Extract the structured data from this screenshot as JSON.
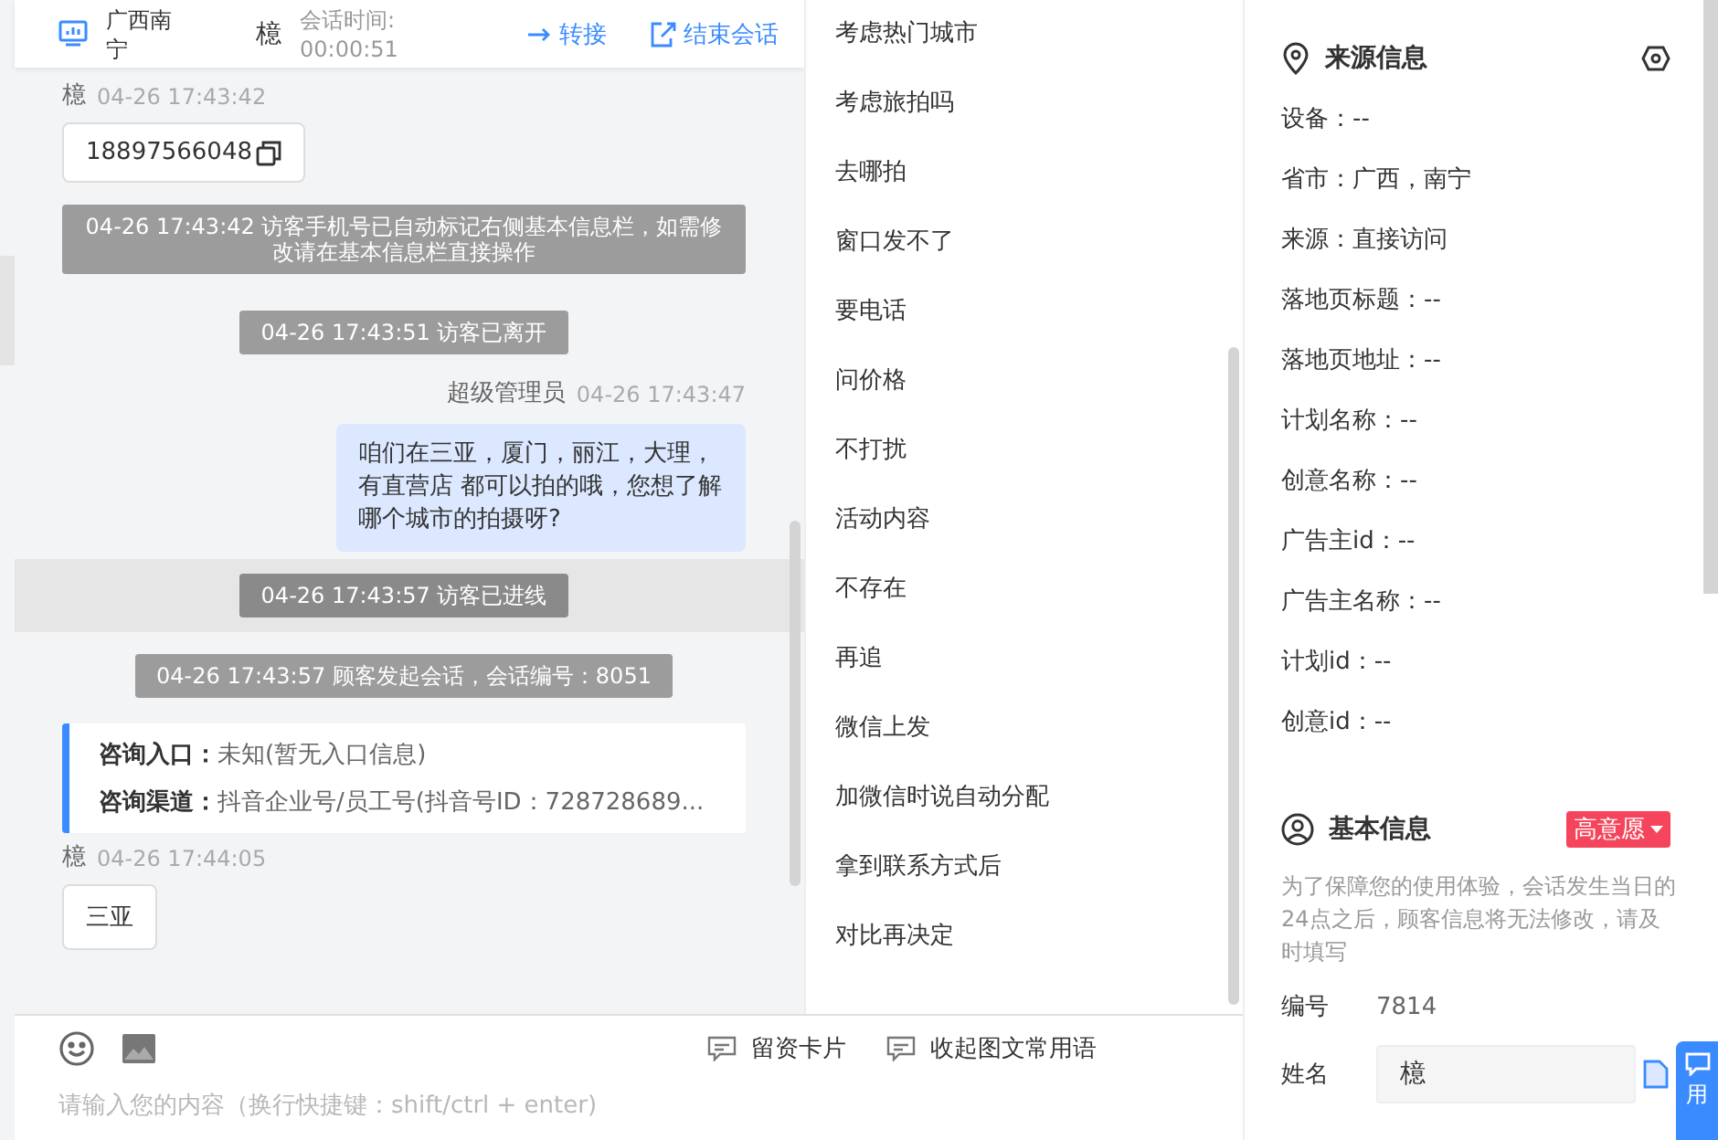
{
  "chat_header": {
    "location": "广西南宁",
    "visitor": "檍",
    "timer_label": "会话时间:",
    "timer": "00:00:51",
    "actions": [
      {
        "label": "转接",
        "kind": "transfer"
      },
      {
        "label": "结束会话",
        "kind": "end"
      }
    ]
  },
  "messages": [
    {
      "kind": "visitor",
      "sender": "檍",
      "time": "04-26 17:43:42",
      "text": "18897566048",
      "copyable": true
    },
    {
      "kind": "notice",
      "text": "04-26 17:43:42 访客手机号已自动标记右侧基本信息栏，如需修改请在基本信息栏直接操作",
      "highlighted": false
    },
    {
      "kind": "notice",
      "text": "04-26 17:43:51 访客已离开",
      "highlighted": false
    },
    {
      "kind": "agent",
      "sender": "超级管理员",
      "time": "04-26 17:43:47",
      "text": "咱们在三亚，厦门，丽江，大理，有直营店 都可以拍的哦，您想了解哪个城市的拍摄呀?"
    },
    {
      "kind": "notice",
      "text": "04-26 17:43:57 访客已进线",
      "highlighted": true
    },
    {
      "kind": "notice",
      "text": "04-26 17:43:57 顾客发起会话，会话编号：8051",
      "highlighted": false
    },
    {
      "kind": "card",
      "rows": [
        {
          "label": "咨询入口：",
          "value": "未知(暂无入口信息)"
        },
        {
          "label": "咨询渠道：",
          "value": "抖音企业号/员工号(抖音号ID：728728689..."
        }
      ]
    },
    {
      "kind": "visitor",
      "sender": "檍",
      "time": "04-26 17:44:05",
      "text": "三亚",
      "copyable": false
    }
  ],
  "quick_phrases": [
    "考虑热门城市",
    "考虑旅拍吗",
    "去哪拍",
    "窗口发不了",
    "要电话",
    "问价格",
    "不打扰",
    "活动内容",
    "不存在",
    "再追",
    "微信上发",
    "加微信时说自动分配",
    "拿到联系方式后",
    "对比再决定"
  ],
  "composer": {
    "tools": [
      {
        "label": "留资卡片"
      },
      {
        "label": "收起图文常用语"
      }
    ],
    "placeholder": "请输入您的内容（换行快捷键：shift/ctrl + enter)"
  },
  "source_info": {
    "title": "来源信息",
    "fields": [
      "设备：--",
      "省市：广西，南宁",
      "来源：直接访问",
      "落地页标题：--",
      "落地页地址：--",
      "计划名称：--",
      "创意名称：--",
      "广告主id：--",
      "广告主名称：--",
      "计划id：--",
      "创意id：--"
    ]
  },
  "basic_info": {
    "title": "基本信息",
    "tag": {
      "label": "高意愿",
      "color": "#f5455c"
    },
    "notice": "为了保障您的使用体验，会话发生当日的24点之后，顾客信息将无法修改，请及时填写",
    "fields": [
      {
        "label": "编号",
        "value": "7814",
        "kind": "text"
      },
      {
        "label": "姓名",
        "value": "檍",
        "kind": "input"
      }
    ]
  },
  "float_button": {
    "label": "用"
  }
}
